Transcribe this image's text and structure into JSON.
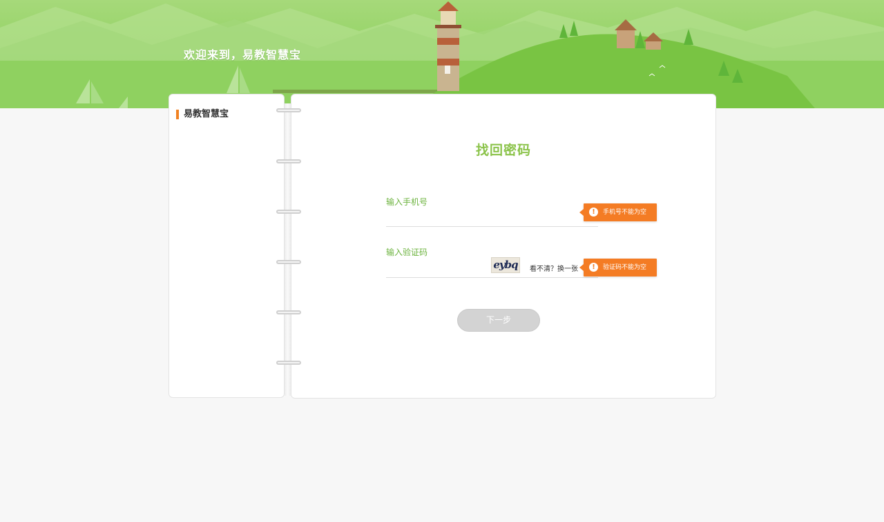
{
  "banner": {
    "welcome_text": "欢迎来到，易教智慧宝"
  },
  "sidebar": {
    "title": "易教智慧宝"
  },
  "form": {
    "title": "找回密码",
    "phone": {
      "label": "输入手机号",
      "value": "",
      "error": "手机号不能为空"
    },
    "code": {
      "label": "输入验证码",
      "value": "",
      "error": "验证码不能为空"
    },
    "captcha_text": "eybq",
    "refresh_label": "看不清？换一张",
    "next_label": "下一步"
  },
  "colors": {
    "accent_green": "#8bc34a",
    "label_green": "#6db33f",
    "error_orange": "#f47c24",
    "sidebar_marker": "#f08121"
  },
  "icons": {
    "error": "exclamation-circle-icon"
  }
}
